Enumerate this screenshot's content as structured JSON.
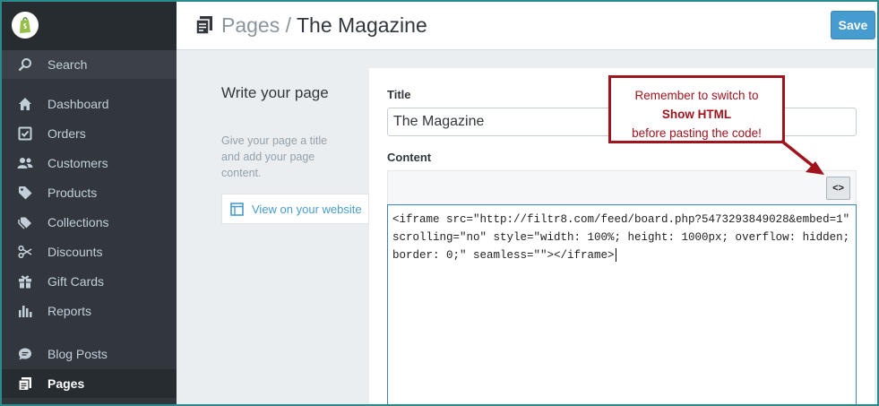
{
  "sidebar": {
    "search_label": "Search",
    "items": [
      {
        "label": "Dashboard"
      },
      {
        "label": "Orders"
      },
      {
        "label": "Customers"
      },
      {
        "label": "Products"
      },
      {
        "label": "Collections"
      },
      {
        "label": "Discounts"
      },
      {
        "label": "Gift Cards"
      },
      {
        "label": "Reports"
      },
      {
        "label": "Blog Posts"
      },
      {
        "label": "Pages"
      }
    ],
    "active": "Pages"
  },
  "header": {
    "section": "Pages",
    "separator": "/",
    "current": "The Magazine",
    "save_label": "Save"
  },
  "info": {
    "heading": "Write your page",
    "description": "Give your page a title and add your page content.",
    "view_link": "View on your website"
  },
  "form": {
    "title_label": "Title",
    "title_value": "The Magazine",
    "content_label": "Content",
    "html_button": "<>",
    "code": "<iframe src=\"http://filtr8.com/feed/board.php?5473293849028&embed=1\" scrolling=\"no\" style=\"width: 100%; height: 1000px; overflow: hidden; border: 0;\" seamless=\"\"></iframe>"
  },
  "annotation": {
    "line1": "Remember to switch to",
    "line2": "Show HTML",
    "line3": "before pasting the code!"
  },
  "colors": {
    "sidebar_bg": "#31373d",
    "accent": "#479ccf",
    "annotation": "#a0141e"
  }
}
